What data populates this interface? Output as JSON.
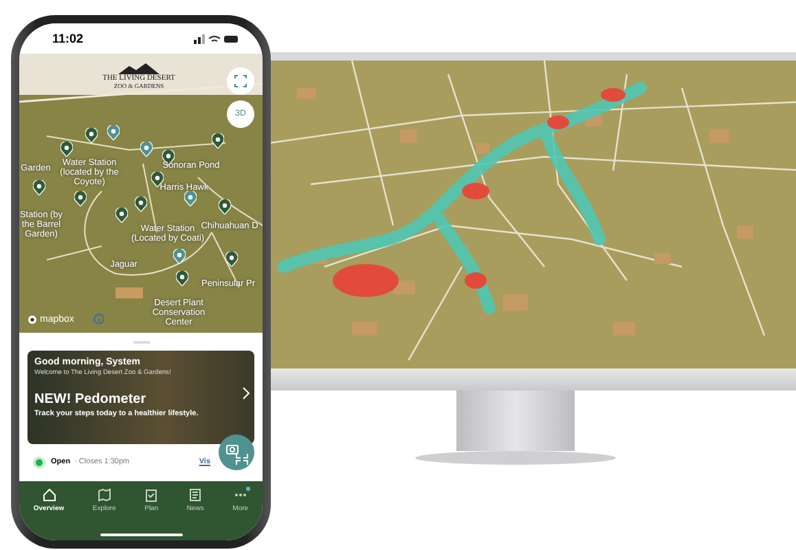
{
  "monitor": {
    "kind": "heatmap-map"
  },
  "phone": {
    "status_bar": {
      "time": "11:02"
    },
    "logo": {
      "line1": "THE LIVING DESERT",
      "line2": "ZOO & GARDENS"
    },
    "map": {
      "button_3d": "3D",
      "attribution": "mapbox",
      "labels": [
        {
          "text": "Garden"
        },
        {
          "text": "Water Station (located by the Coyote)"
        },
        {
          "text": "Sonoran Pond"
        },
        {
          "text": "Harris Hawk"
        },
        {
          "text": "Station (by the Barrel Garden)"
        },
        {
          "text": "Water Station (Located by Coati)"
        },
        {
          "text": "Chihuahuan D"
        },
        {
          "text": "Jaguar"
        },
        {
          "text": "Peninsular Pr"
        },
        {
          "text": "Desert Plant Conservation Center"
        }
      ]
    },
    "card": {
      "greeting": "Good morning, System",
      "welcome": "Welcome to The Living Desert Zoo & Gardens!",
      "title": "NEW! Pedometer",
      "description": "Track your steps today to a healthier lifestyle.",
      "status": "Open",
      "hours": "· Closes 1:30pm",
      "link": "Vis"
    },
    "tabs": [
      {
        "label": "Overview",
        "selected": true,
        "badge": false
      },
      {
        "label": "Explore",
        "selected": false,
        "badge": false
      },
      {
        "label": "Plan",
        "selected": false,
        "badge": false
      },
      {
        "label": "News",
        "selected": false,
        "badge": false
      },
      {
        "label": "More",
        "selected": false,
        "badge": true
      }
    ]
  }
}
